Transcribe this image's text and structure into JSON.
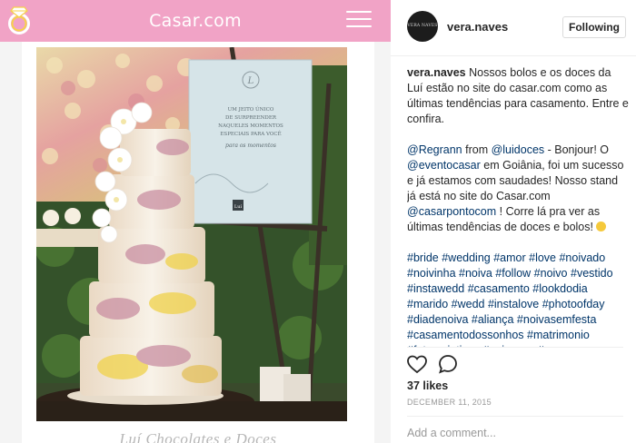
{
  "site": {
    "title": "Casar.com",
    "menu_icon": "hamburger-icon",
    "logo_icon": "ring-icon",
    "caption": "Luí Chocolates e Doces",
    "brand_color": "#f1a3c6",
    "sign_lines": [
      "UM JEITO ÚNICO",
      "DE SURPREENDER",
      "NAQUELES MOMENTOS",
      "ESPECIAIS PARA VOCÊ"
    ],
    "sign_script": "para os momentos",
    "sign_brand": "Luí"
  },
  "post": {
    "avatar_text": "VERA NAVES",
    "username": "vera.naves",
    "follow_label": "Following",
    "caption": {
      "username": "vera.naves",
      "text": " Nossos bolos e os doces da Luí estão no site do casar.com como as últimas tendências para casamento. Entre e confira."
    },
    "regram": {
      "mention1": "@Regrann",
      "text1": " from ",
      "mention2": "@luidoces",
      "text2": " - Bonjour! O ",
      "mention3": "@eventocasar",
      "text3": " em Goiânia, foi um sucesso e já estamos com saudades! Nosso stand já está no site do Casar.com ",
      "mention4": "@casarpontocom",
      "text4": " ! Corre lá pra ver as últimas tendências de doces e bolos! "
    },
    "hashtags": "#bride #wedding #amor #love #noivado #noivinha #noiva #follow #noivo #vestido #instawedd #casamento #lookdodia #marido #wedd #instalove #photoofday #diadenoiva #aliança #noivasemfesta #casamentodossonhos #matrimonio #fotoscriativas #noivasgo #amor #weddingcake #bolodecasamento #bridetobe #mariage #nosso #casuida",
    "like_icon": "heart-icon",
    "comment_icon": "comment-icon",
    "likes": "37 likes",
    "date": "DECEMBER 11, 2015",
    "comment_placeholder": "Add a comment..."
  }
}
